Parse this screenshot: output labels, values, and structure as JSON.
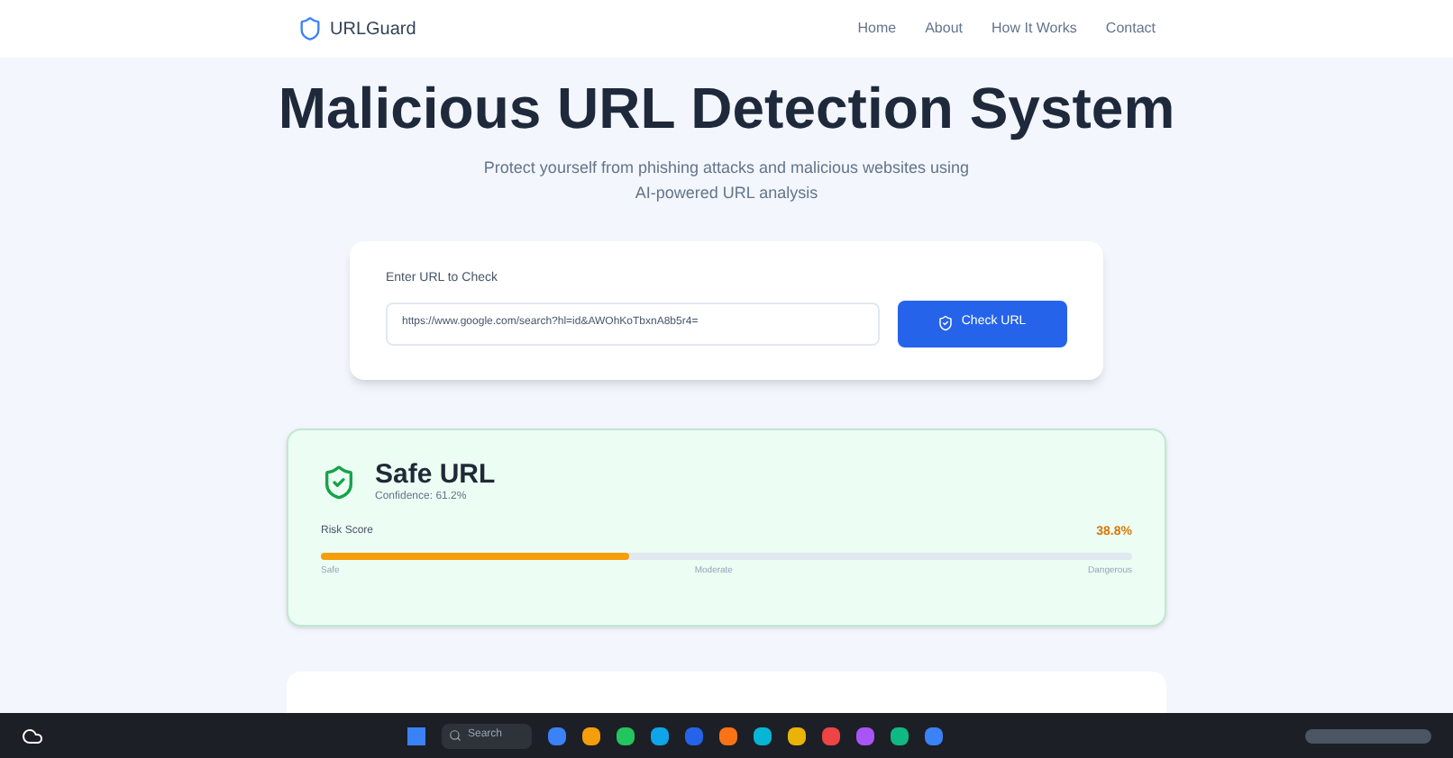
{
  "nav": {
    "brand": "URLGuard",
    "links": [
      "Home",
      "About",
      "How It Works",
      "Contact"
    ]
  },
  "hero": {
    "title": "Malicious URL Detection System",
    "subtitle": "Protect yourself from phishing attacks and malicious websites using AI-powered URL analysis"
  },
  "form": {
    "label": "Enter URL to Check",
    "value": "https://www.google.com/search?hl=id&AWOhKoTbxnA8b5r4=",
    "button": "Check URL"
  },
  "result": {
    "kind": "safe",
    "title": "Safe URL",
    "confidence": "Confidence: 61.2%",
    "risk_label": "Risk Score",
    "risk_value": "38.8%",
    "level": 0.38,
    "scale": [
      "Safe",
      "Moderate",
      "Dangerous"
    ]
  },
  "taskbar": {
    "search": "Search"
  }
}
